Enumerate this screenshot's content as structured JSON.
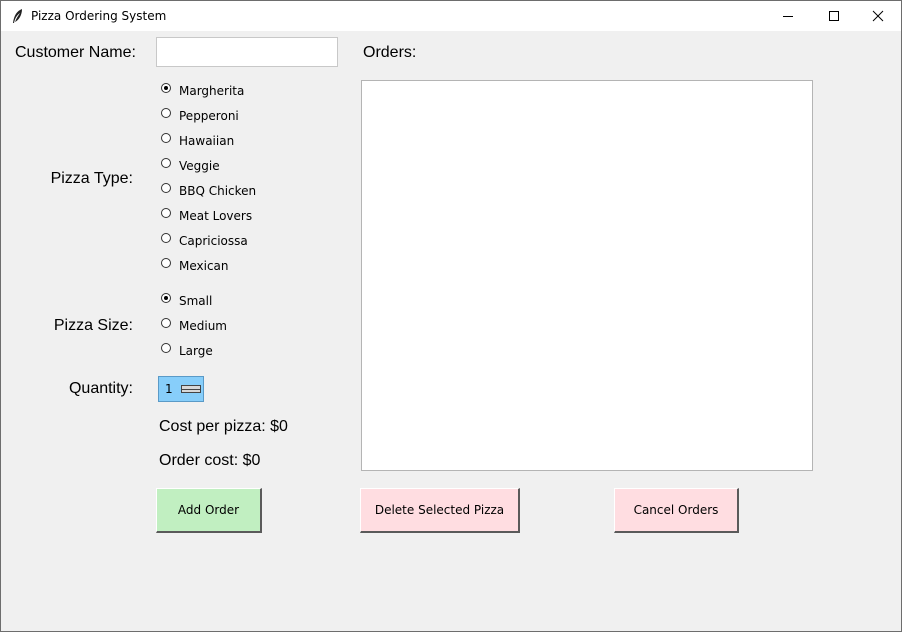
{
  "window": {
    "title": "Pizza Ordering System"
  },
  "form": {
    "customer_name_label": "Customer Name:",
    "customer_name_value": "",
    "pizza_type_label": "Pizza Type:",
    "pizza_types": [
      "Margherita",
      "Pepperoni",
      "Hawaiian",
      "Veggie",
      "BBQ Chicken",
      "Meat Lovers",
      "Capriciossa",
      "Mexican"
    ],
    "pizza_type_selected": "Margherita",
    "pizza_size_label": "Pizza Size:",
    "pizza_sizes": [
      "Small",
      "Medium",
      "Large"
    ],
    "pizza_size_selected": "Small",
    "quantity_label": "Quantity:",
    "quantity_value": "1",
    "cost_per_pizza": "Cost per pizza: $0",
    "order_cost": "Order cost: $0"
  },
  "orders": {
    "label": "Orders:",
    "items": []
  },
  "buttons": {
    "add": "Add Order",
    "delete": "Delete Selected Pizza",
    "cancel": "Cancel Orders"
  },
  "colors": {
    "add_button": "#c1efc1",
    "delete_button": "#ffdde1",
    "cancel_button": "#ffdde1",
    "spinbox": "#87cefa"
  },
  "icons": {
    "app": "feather-icon",
    "minimize": "minimize-icon",
    "maximize": "maximize-icon",
    "close": "close-icon"
  }
}
